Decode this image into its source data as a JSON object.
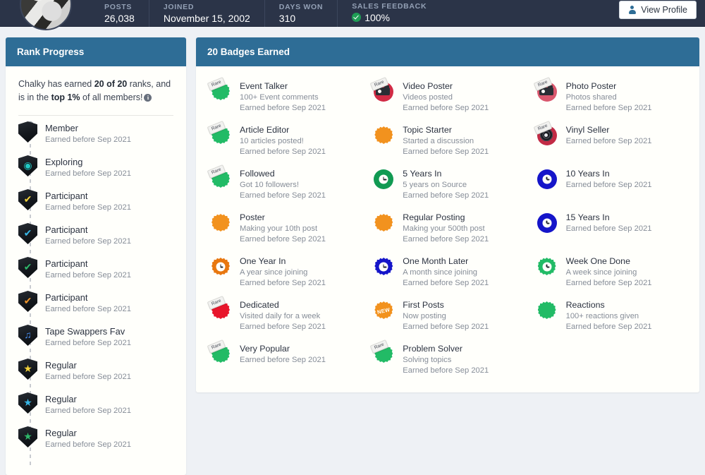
{
  "topbar": {
    "avatar_alt": "user-avatar",
    "stats": [
      {
        "label": "POSTS",
        "value": "26,038"
      },
      {
        "label": "JOINED",
        "value": "November 15, 2002"
      },
      {
        "label": "DAYS WON",
        "value": "310"
      },
      {
        "label": "SALES FEEDBACK",
        "value": "100%",
        "has_check": true
      }
    ],
    "view_profile_label": "View Profile"
  },
  "rank_panel": {
    "title": "Rank Progress",
    "intro_pre": "Chalky has earned ",
    "intro_ranks": "20 of 20",
    "intro_mid": " ranks, and is in the ",
    "intro_top": "top 1%",
    "intro_post": " of all members!",
    "info_glyph": "i",
    "ranks": [
      {
        "name": "Member",
        "sub": "Earned before Sep 2021",
        "glyph": "",
        "color": "#1b1f25"
      },
      {
        "name": "Exploring",
        "sub": "Earned before Sep 2021",
        "glyph": "◉",
        "color": "#21c9c4"
      },
      {
        "name": "Participant",
        "sub": "Earned before Sep 2021",
        "glyph": "✔",
        "color": "#f2d23b"
      },
      {
        "name": "Participant",
        "sub": "Earned before Sep 2021",
        "glyph": "✔",
        "color": "#37b6e6"
      },
      {
        "name": "Participant",
        "sub": "Earned before Sep 2021",
        "glyph": "✔",
        "color": "#2fb86a"
      },
      {
        "name": "Participant",
        "sub": "Earned before Sep 2021",
        "glyph": "✔",
        "color": "#f0962c"
      },
      {
        "name": "Tape Swappers Fav",
        "sub": "Earned before Sep 2021",
        "glyph": "♫",
        "color": "#4a8ff0"
      },
      {
        "name": "Regular",
        "sub": "Earned before Sep 2021",
        "glyph": "★",
        "color": "#f2d23b"
      },
      {
        "name": "Regular",
        "sub": "Earned before Sep 2021",
        "glyph": "★",
        "color": "#37b6e6"
      },
      {
        "name": "Regular",
        "sub": "Earned before Sep 2021",
        "glyph": "★",
        "color": "#2fb86a"
      }
    ]
  },
  "badges_panel": {
    "title": "20 Badges Earned",
    "rare_label": "Rare",
    "new_label": "NEW",
    "badges": [
      {
        "name": "Event Talker",
        "desc": "100+ Event comments",
        "earned": "Earned before Sep 2021",
        "icon": "starburst",
        "color": "#22bb66",
        "rare": true
      },
      {
        "name": "Video Poster",
        "desc": "Videos posted",
        "earned": "Earned before Sep 2021",
        "icon": "camera",
        "color": "#d12b45",
        "rare": true
      },
      {
        "name": "Photo Poster",
        "desc": "Photos shared",
        "earned": "Earned before Sep 2021",
        "icon": "camera",
        "color": "#d9576d",
        "rare": true
      },
      {
        "name": "Article Editor",
        "desc": "10 articles posted!",
        "earned": "Earned before Sep 2021",
        "icon": "starburst",
        "color": "#22bb66",
        "rare": true
      },
      {
        "name": "Topic Starter",
        "desc": "Started a discussion",
        "earned": "Earned before Sep 2021",
        "icon": "starburst",
        "color": "#f2921e",
        "rare": false
      },
      {
        "name": "Vinyl Seller",
        "desc": "",
        "earned": "Earned before Sep 2021",
        "icon": "vinyl",
        "color": "#c22b45",
        "rare": true
      },
      {
        "name": "Followed",
        "desc": "Got 10 followers!",
        "earned": "Earned before Sep 2021",
        "icon": "starburst",
        "color": "#22bb66",
        "rare": true
      },
      {
        "name": "5 Years In",
        "desc": "5 years on Source",
        "earned": "Earned before Sep 2021",
        "icon": "clockdisc",
        "color": "#119a52",
        "rare": false
      },
      {
        "name": "10 Years In",
        "desc": "",
        "earned": "Earned before Sep 2021",
        "icon": "clockdisc",
        "color": "#1515c9",
        "rare": false
      },
      {
        "name": "Poster",
        "desc": "Making your 10th post",
        "earned": "Earned before Sep 2021",
        "icon": "starburst",
        "color": "#f2921e",
        "rare": false
      },
      {
        "name": "Regular Posting",
        "desc": "Making your 500th post",
        "earned": "Earned before Sep 2021",
        "icon": "starburst",
        "color": "#f2921e",
        "rare": false
      },
      {
        "name": "15 Years In",
        "desc": "",
        "earned": "Earned before Sep 2021",
        "icon": "clockdisc",
        "color": "#1515c9",
        "rare": false
      },
      {
        "name": "One Year In",
        "desc": "A year since joining",
        "earned": "Earned before Sep 2021",
        "icon": "clockburst",
        "color": "#e8770f",
        "rare": false
      },
      {
        "name": "One Month Later",
        "desc": "A month since joining",
        "earned": "Earned before Sep 2021",
        "icon": "clockburst",
        "color": "#1515c9",
        "rare": false
      },
      {
        "name": "Week One Done",
        "desc": "A week since joining",
        "earned": "Earned before Sep 2021",
        "icon": "clockburst",
        "color": "#22bb66",
        "rare": false
      },
      {
        "name": "Dedicated",
        "desc": "Visited daily for a week",
        "earned": "Earned before Sep 2021",
        "icon": "starburst",
        "color": "#e8152b",
        "rare": true
      },
      {
        "name": "First Posts",
        "desc": "Now posting",
        "earned": "Earned before Sep 2021",
        "icon": "newburst",
        "color": "#f2921e",
        "rare": false
      },
      {
        "name": "Reactions",
        "desc": "100+ reactions given",
        "earned": "Earned before Sep 2021",
        "icon": "starburst",
        "color": "#22bb66",
        "rare": false
      },
      {
        "name": "Very Popular",
        "desc": "",
        "earned": "Earned before Sep 2021",
        "icon": "starburst",
        "color": "#22bb66",
        "rare": true
      },
      {
        "name": "Problem Solver",
        "desc": "Solving topics",
        "earned": "Earned before Sep 2021",
        "icon": "starburst",
        "color": "#22bb66",
        "rare": true
      }
    ]
  },
  "colors": {
    "topbar_bg": "#2b3448",
    "panel_header": "#2e6d96",
    "page_bg": "#eef1f5",
    "panel_bg": "#fffffb",
    "muted_text": "#868d98"
  }
}
